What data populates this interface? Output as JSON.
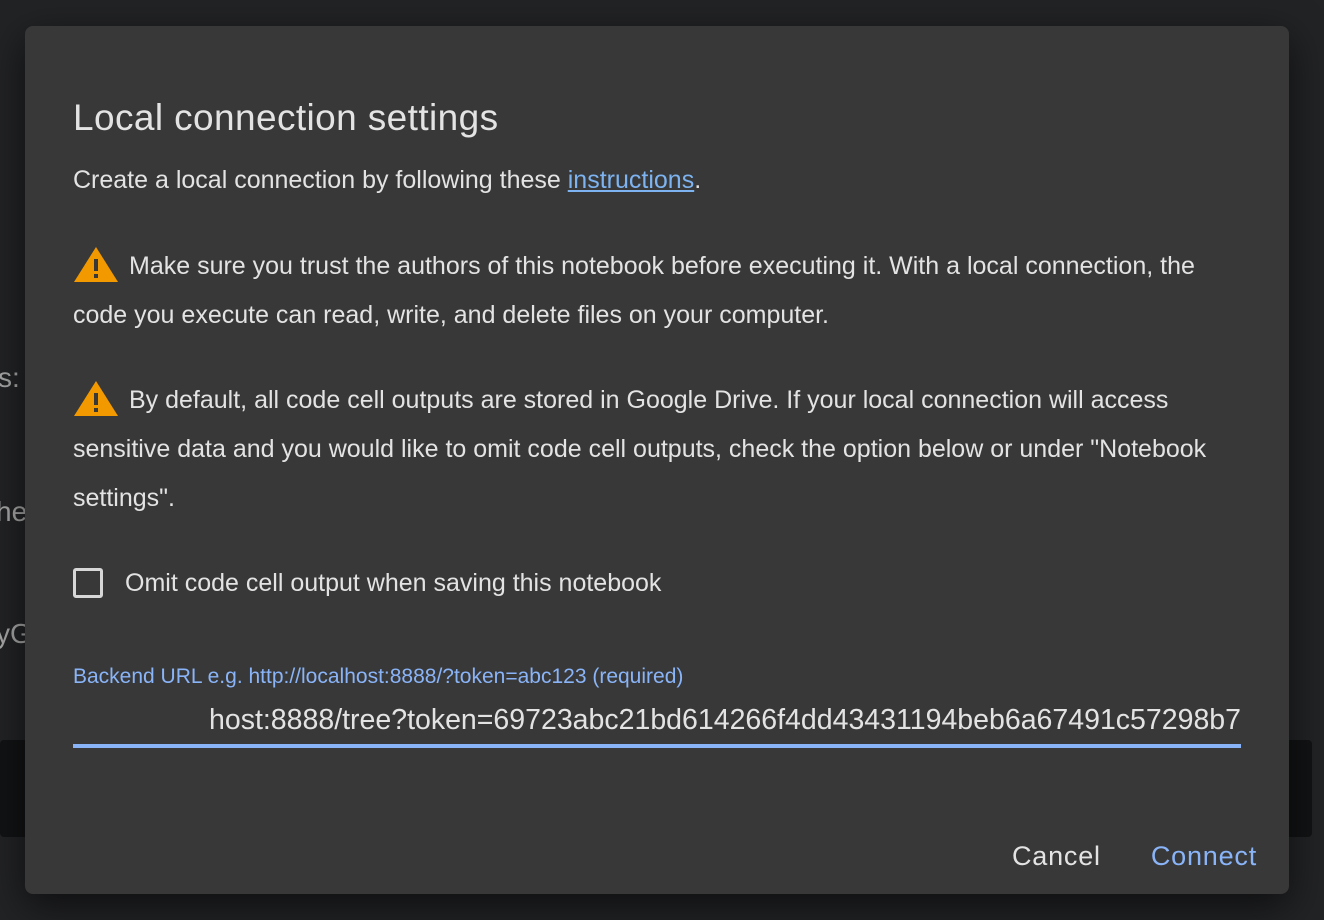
{
  "background": {
    "fragments": [
      "s:",
      "he",
      "yG"
    ]
  },
  "dialog": {
    "title": "Local connection settings",
    "intro_before": "Create a local connection by following these ",
    "intro_link": "instructions",
    "intro_after": ".",
    "warnings": [
      "Make sure you trust the authors of this notebook before executing it. With a local connection, the code you execute can read, write, and delete files on your computer.",
      "By default, all code cell outputs are stored in Google Drive. If your local connection will access sensitive data and you would like to omit code cell outputs, check the option below or under \"Notebook settings\"."
    ],
    "omit_checkbox": {
      "label": "Omit code cell output when saving this notebook",
      "checked": false
    },
    "backend_url": {
      "label": "Backend URL e.g. http://localhost:8888/?token=abc123 (required)",
      "value": "host:8888/tree?token=69723abc21bd614266f4dd43431194beb6a67491c57298b7"
    },
    "buttons": {
      "cancel": "Cancel",
      "connect": "Connect"
    }
  },
  "colors": {
    "dialog_bg": "#383838",
    "accent": "#8ab4f8",
    "link": "#7db3f0",
    "warning": "#f29900"
  }
}
